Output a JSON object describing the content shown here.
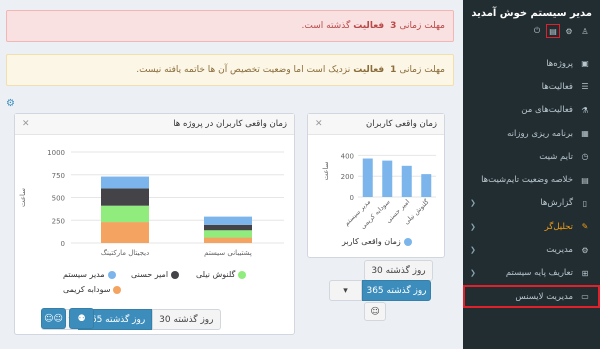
{
  "sidebar": {
    "title": "مدیر سیستم خوش آمدید",
    "items": [
      {
        "label": "پروژه‌ها",
        "icon": "briefcase-icon",
        "glyph": "▣",
        "caret": false
      },
      {
        "label": "فعالیت‌ها",
        "icon": "list-icon",
        "glyph": "☰",
        "caret": false
      },
      {
        "label": "فعالیت‌های من",
        "icon": "flask-icon",
        "glyph": "⚗",
        "caret": false
      },
      {
        "label": "برنامه ریزی روزانه",
        "icon": "calendar-icon",
        "glyph": "▦",
        "caret": false
      },
      {
        "label": "تایم شیت",
        "icon": "clock-icon",
        "glyph": "◷",
        "caret": false
      },
      {
        "label": "خلاصه وضعیت تایم‌شیت‌ها",
        "icon": "summary-icon",
        "glyph": "▤",
        "caret": false
      },
      {
        "label": "گزارش‌ها",
        "icon": "file-icon",
        "glyph": "▯",
        "caret": true
      },
      {
        "label": "تحلیل‌گر",
        "icon": "pencil-icon",
        "glyph": "✎",
        "caret": true
      },
      {
        "label": "مدیریت",
        "icon": "gear-icon",
        "glyph": "⚙",
        "caret": true
      },
      {
        "label": "تعاریف پایه سیستم",
        "icon": "grid-icon",
        "glyph": "⊞",
        "caret": true
      },
      {
        "label": "مدیریت لایسنس",
        "icon": "license-icon",
        "glyph": "▭",
        "caret": false
      }
    ]
  },
  "alerts": {
    "red": {
      "prefix": "مهلت زمانی",
      "count": "3",
      "word": "فعالیت",
      "suffix": "گذشته است."
    },
    "yellow": {
      "prefix": "مهلت زمانی",
      "count": "1",
      "word": "فعالیت",
      "suffix": "نزدیک است اما وضعیت تخصیص آن ها خاتمه یافته نیست."
    }
  },
  "panels": {
    "big": {
      "title": "زمان واقعی کاربران در پروژه ها",
      "buttons": {
        "b30": "30 روز گذشته",
        "b365": "365 روز گذشته",
        "more": "...",
        "caret": "▾"
      }
    },
    "small": {
      "title": "زمان واقعی کاربران",
      "buttons": {
        "b30": "30 روز گذشته",
        "b365": "365 روز گذشته",
        "more": "▾"
      }
    }
  },
  "chart_data": [
    {
      "type": "bar",
      "stacked": true,
      "title": "زمان واقعی کاربران در پروژه ها",
      "categories": [
        "دیجیتال مارکتینگ",
        "پشتیبانی سیستم"
      ],
      "ylabel": "ساعت",
      "ylim": [
        0,
        1000
      ],
      "yticks": [
        0,
        250,
        500,
        750,
        1000
      ],
      "series": [
        {
          "name": "سودابه کریمی",
          "color": "#f4a460",
          "values": [
            230,
            60
          ]
        },
        {
          "name": "گلنوش نیلی",
          "color": "#90ed7d",
          "values": [
            180,
            80
          ]
        },
        {
          "name": "امیر حسنی",
          "color": "#434348",
          "values": [
            190,
            60
          ]
        },
        {
          "name": "مدیر سیستم",
          "color": "#7cb5ec",
          "values": [
            130,
            90
          ]
        }
      ],
      "legend": "bottom"
    },
    {
      "type": "bar",
      "title": "زمان واقعی کاربران",
      "categories": [
        "مدیر سیستم",
        "سودابه کریمی",
        "امیر حسنی",
        "گلنوش نیلی"
      ],
      "ylabel": "ساعت",
      "ylim": [
        0,
        500
      ],
      "yticks": [
        0,
        200,
        400
      ],
      "series": [
        {
          "name": "زمان واقعی کاربر",
          "color": "#7cb5ec",
          "values": [
            370,
            350,
            300,
            220
          ]
        }
      ],
      "legend": "bottom"
    }
  ]
}
